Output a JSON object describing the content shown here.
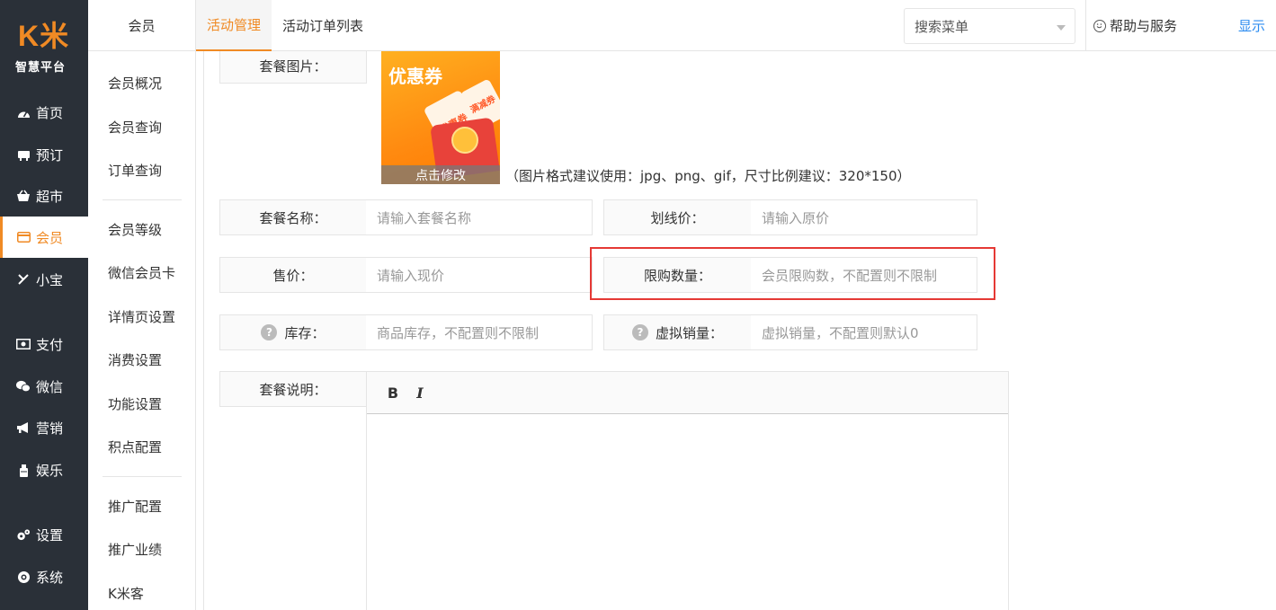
{
  "brand": {
    "logo": "K米",
    "subtitle": "智慧平台",
    "accent": "#f08a24"
  },
  "sidebar": {
    "items": [
      {
        "label": "首页",
        "icon": "dashboard-icon"
      },
      {
        "label": "预订",
        "icon": "reserve-icon"
      },
      {
        "label": "超市",
        "icon": "basket-icon"
      },
      {
        "label": "会员",
        "icon": "card-icon",
        "active": true
      },
      {
        "label": "小宝",
        "icon": "xiaobao-icon"
      },
      {
        "label": "支付",
        "icon": "money-icon"
      },
      {
        "label": "微信",
        "icon": "wechat-icon"
      },
      {
        "label": "营销",
        "icon": "megaphone-icon"
      },
      {
        "label": "娱乐",
        "icon": "entertainment-icon"
      },
      {
        "label": "设置",
        "icon": "gears-icon"
      },
      {
        "label": "系统",
        "icon": "system-icon"
      }
    ]
  },
  "subnav": {
    "title": "会员",
    "items": [
      "会员概况",
      "会员查询",
      "订单查询",
      "会员等级",
      "微信会员卡",
      "详情页设置",
      "消费设置",
      "功能设置",
      "积点配置",
      "推广配置",
      "推广业绩",
      "K米客"
    ]
  },
  "header": {
    "tabs": [
      "活动管理",
      "活动订单列表"
    ],
    "search_placeholder": "搜索菜单",
    "help": "帮助与服务",
    "show": "显示"
  },
  "form": {
    "image_label": "套餐图片：",
    "image_title": "优惠券",
    "image_coupon1": "优惠券",
    "image_coupon2": "满减券",
    "image_edit": "点击修改",
    "image_hint": "（图片格式建议使用：jpg、png、gif，尺寸比例建议：320*150）",
    "name_label": "套餐名称：",
    "name_placeholder": "请输入套餐名称",
    "original_label": "划线价：",
    "original_placeholder": "请输入原价",
    "price_label": "售价：",
    "price_placeholder": "请输入现价",
    "limit_label": "限购数量：",
    "limit_placeholder": "会员限购数，不配置则不限制",
    "stock_label": "库存：",
    "stock_placeholder": "商品库存，不配置则不限制",
    "virtual_label": "虚拟销量：",
    "virtual_placeholder": "虚拟销量，不配置则默认0",
    "desc_label": "套餐说明：",
    "bold": "B",
    "italic": "I"
  }
}
